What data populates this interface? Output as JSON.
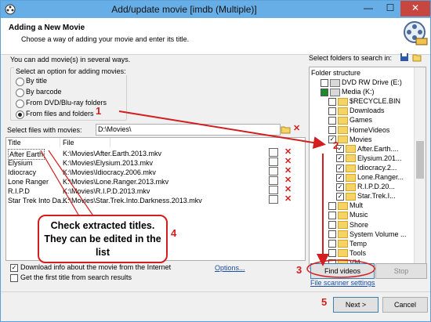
{
  "window": {
    "title": "Add/update movie [imdb (Multiple)]",
    "min_label": "—",
    "max_label": "☐",
    "close_label": "✕"
  },
  "header": {
    "title": "Adding a New Movie",
    "subtitle": "Choose a way of adding your movie and enter its title."
  },
  "left": {
    "intro": "You can add movie(s) in several ways.",
    "group_label": "Select an option for adding movies:",
    "options": [
      {
        "label": "By title",
        "selected": false
      },
      {
        "label": "By barcode",
        "selected": false
      },
      {
        "label": "From DVD/Blu-ray folders",
        "selected": false
      },
      {
        "label": "From files and folders",
        "selected": true
      }
    ],
    "files_label": "Select files with movies:",
    "path_value": "D:\\Movies\\",
    "columns": [
      "Title",
      "File"
    ],
    "rows": [
      {
        "title": "After Earth",
        "file": "K:\\Movies\\After.Earth.2013.mkv"
      },
      {
        "title": "Elysium",
        "file": "K:\\Movies\\Elysium.2013.mkv"
      },
      {
        "title": "Idiocracy",
        "file": "K:\\Movies\\Idiocracy.2006.mkv"
      },
      {
        "title": "Lone Ranger",
        "file": "K:\\Movies\\Lone.Ranger.2013.mkv"
      },
      {
        "title": "R.I.P.D",
        "file": "K:\\Movies\\R.I.P.D.2013.mkv"
      },
      {
        "title": "Star Trek Into Da...",
        "file": "K:\\Movies\\Star.Trek.Into.Darkness.2013.mkv"
      }
    ],
    "download_label": "Download info about the movie from the Internet",
    "download_checked": true,
    "first_title_label": "Get the first title from search results",
    "first_title_checked": false,
    "options_link": "Options..."
  },
  "right": {
    "select_label": "Select folders to search in:",
    "tree_header": "Folder structure",
    "nodes": [
      {
        "label": "DVD RW Drive (E:)",
        "checked": false,
        "icon": "drive-icon",
        "level": 1
      },
      {
        "label": "Media (K:)",
        "checked": "partial",
        "icon": "drive-icon",
        "level": 1
      },
      {
        "label": "$RECYCLE.BIN",
        "checked": false,
        "icon": "folder-icon",
        "level": 2
      },
      {
        "label": "Downloads",
        "checked": false,
        "icon": "folder-icon",
        "level": 2
      },
      {
        "label": "Games",
        "checked": false,
        "icon": "folder-icon",
        "level": 2
      },
      {
        "label": "HomeVideos",
        "checked": false,
        "icon": "folder-icon",
        "level": 2
      },
      {
        "label": "Movies",
        "checked": true,
        "icon": "folder-icon",
        "level": 2
      },
      {
        "label": "After.Earth....",
        "checked": true,
        "icon": "folder-icon",
        "level": 3
      },
      {
        "label": "Elysium.201...",
        "checked": true,
        "icon": "folder-icon",
        "level": 3
      },
      {
        "label": "Idiocracy.2...",
        "checked": true,
        "icon": "folder-icon",
        "level": 3
      },
      {
        "label": "Lone.Ranger...",
        "checked": true,
        "icon": "folder-icon",
        "level": 3
      },
      {
        "label": "R.I.P.D.20...",
        "checked": true,
        "icon": "folder-icon",
        "level": 3
      },
      {
        "label": "Star.Trek.I...",
        "checked": true,
        "icon": "folder-icon",
        "level": 3
      },
      {
        "label": "Mult",
        "checked": false,
        "icon": "folder-icon",
        "level": 2
      },
      {
        "label": "Music",
        "checked": false,
        "icon": "folder-icon",
        "level": 2
      },
      {
        "label": "Shore",
        "checked": false,
        "icon": "folder-icon",
        "level": 2
      },
      {
        "label": "System Volume ...",
        "checked": false,
        "icon": "folder-icon",
        "level": 2
      },
      {
        "label": "Temp",
        "checked": false,
        "icon": "folder-icon",
        "level": 2
      },
      {
        "label": "Tools",
        "checked": false,
        "icon": "folder-icon",
        "level": 2
      },
      {
        "label": "VM",
        "checked": false,
        "icon": "folder-icon",
        "level": 2
      }
    ],
    "find_button": "Find videos",
    "stop_button": "Stop",
    "scanner_link": "File scanner settings"
  },
  "footer": {
    "next_button": "Next >",
    "cancel_button": "Cancel"
  },
  "annotations": {
    "n1": "1",
    "n2": "2",
    "n3": "3",
    "n4": "4",
    "n5": "5",
    "callout": "Check extracted titles. They can be edited in the list",
    "color": "#d21e1e"
  }
}
